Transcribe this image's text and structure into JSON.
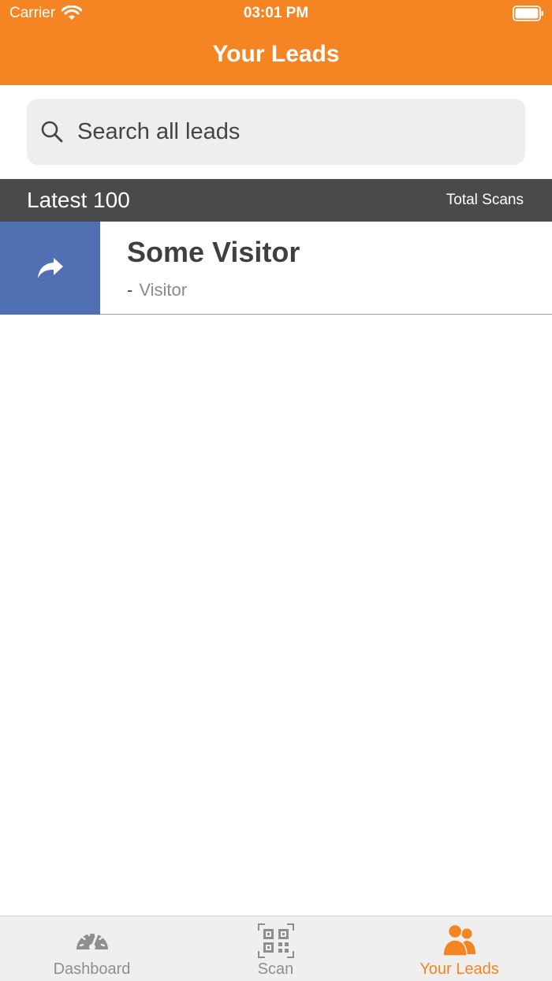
{
  "status_bar": {
    "carrier": "Carrier",
    "time": "03:01 PM"
  },
  "nav": {
    "title": "Your Leads"
  },
  "search": {
    "placeholder": "Search all leads",
    "value": ""
  },
  "section": {
    "title": "Latest 100",
    "right_label": "Total Scans"
  },
  "leads": [
    {
      "name": "Some Visitor",
      "dash": "-",
      "type": "Visitor"
    }
  ],
  "tabs": [
    {
      "label": "Dashboard",
      "icon": "speedometer-icon",
      "active": false
    },
    {
      "label": "Scan",
      "icon": "qr-code-icon",
      "active": false
    },
    {
      "label": "Your Leads",
      "icon": "users-icon",
      "active": true
    }
  ],
  "colors": {
    "brand_orange": "#F58422",
    "share_blue": "#5170B3",
    "section_gray": "#4A4A4A",
    "tab_inactive": "#8e8e8e"
  }
}
